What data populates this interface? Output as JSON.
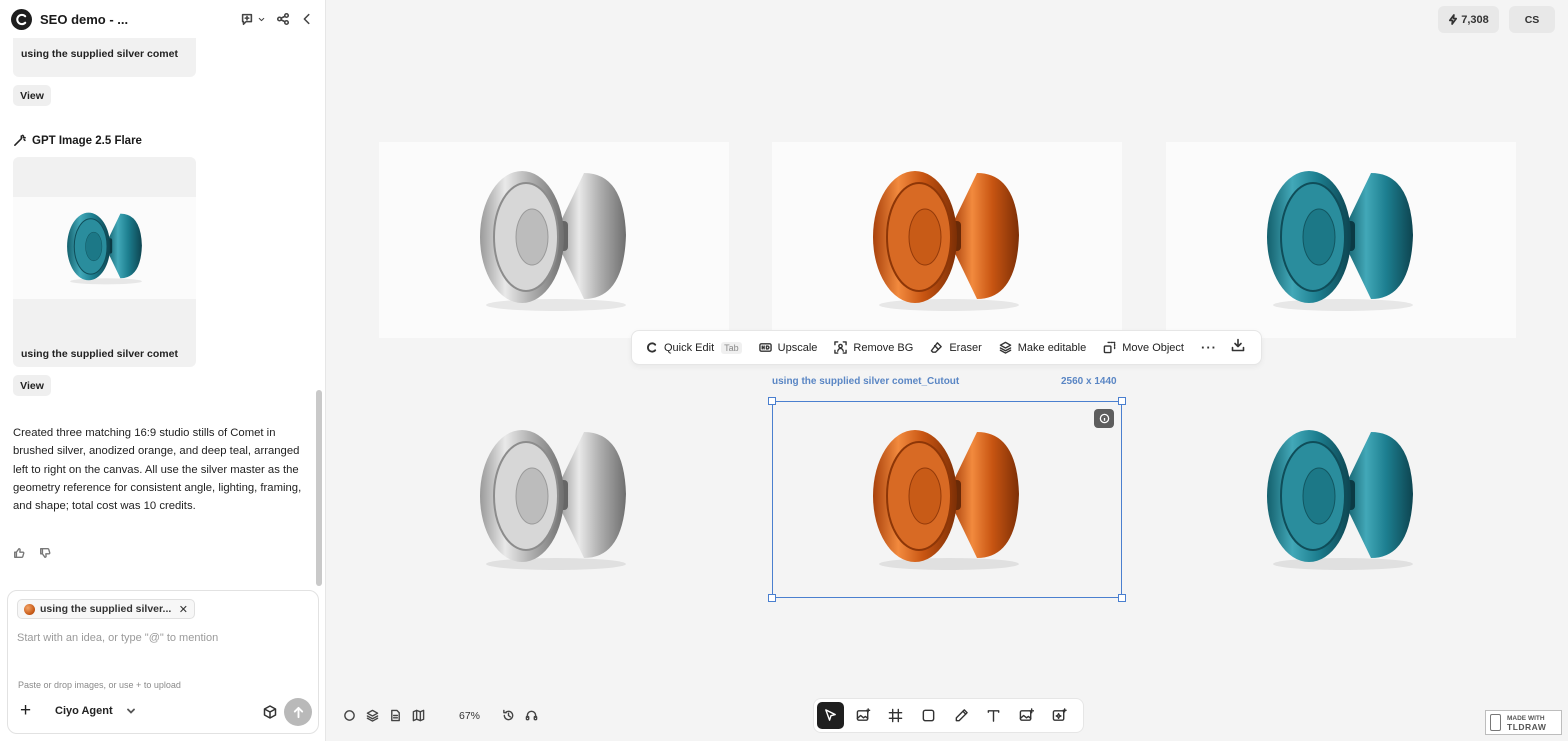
{
  "app": {
    "project_title": "SEO demo - ...",
    "credits": "7,308",
    "user_initials": "CS"
  },
  "sidebar": {
    "card1": {
      "caption": "using the supplied silver comet",
      "view_label": "View"
    },
    "model_name": "GPT Image 2.5 Flare",
    "card2": {
      "caption": "using the supplied silver comet",
      "view_label": "View"
    },
    "summary": "Created three matching 16:9 studio stills of Comet in brushed silver, anodized orange, and deep teal, arranged left to right on the canvas. All use the silver master as the geometry reference for consistent angle, lighting, framing, and shape; total cost was 10 credits."
  },
  "composer": {
    "chip_label": "using the supplied silver...",
    "chip_close": "✕",
    "placeholder": "Start with an idea, or type \"@\" to mention",
    "paste_hint": "Paste or drop images, or use + to upload",
    "plus": "+",
    "agent_label": "Ciyo Agent"
  },
  "toolbar": {
    "quick_edit": "Quick Edit",
    "quick_edit_key": "Tab",
    "upscale": "Upscale",
    "remove_bg": "Remove BG",
    "eraser": "Eraser",
    "make_editable": "Make editable",
    "move_object": "Move Object",
    "more": "···"
  },
  "selection": {
    "label": "using the supplied silver comet_Cutout",
    "dimensions": "2560 x 1440"
  },
  "canvas": {
    "zoom": "67%",
    "colors": {
      "silver": "#c8c8c8",
      "orange": "#d8641c",
      "teal": "#1d7f90",
      "selection": "#4a7fcf"
    }
  },
  "badge": {
    "small": "MADE WITH",
    "big": "TLDRAW"
  }
}
